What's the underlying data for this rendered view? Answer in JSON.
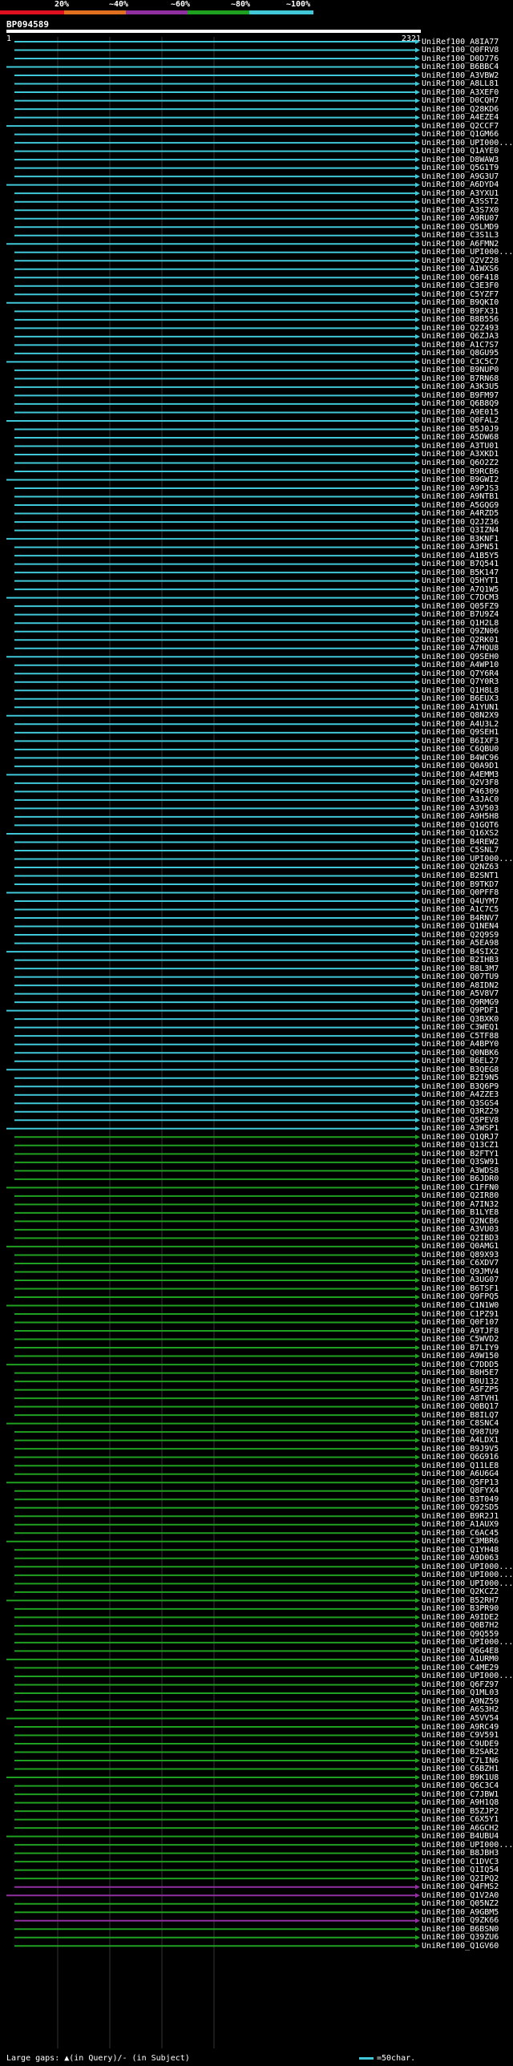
{
  "scale": {
    "labels": [
      "20%",
      "~40%",
      "~60%",
      "~80%",
      "~100%"
    ],
    "colors": [
      "#e01020",
      "#e07020",
      "#9030a0",
      "#20a020",
      "#40c8d8"
    ]
  },
  "query": {
    "name": "BP094589",
    "start": "1",
    "end": "2321"
  },
  "hits": [
    "UniRef100_A8IA77",
    "UniRef100_Q0FRV8",
    "UniRef100_D0D776",
    "UniRef100_B6BBC4",
    "UniRef100_A3VBW2",
    "UniRef100_A8LL81",
    "UniRef100_A3XEF0",
    "UniRef100_D0CQH7",
    "UniRef100_Q28KD6",
    "UniRef100_A4EZE4",
    "UniRef100_Q2CCF7",
    "UniRef100_Q1GM66",
    "UniRef100_UPI000...",
    "UniRef100_Q1AYE0",
    "UniRef100_D8WAW3",
    "UniRef100_Q5G1T9",
    "UniRef100_A9G3U7",
    "UniRef100_A6DYD4",
    "UniRef100_A3YXU1",
    "UniRef100_A3SST2",
    "UniRef100_A3S7X0",
    "UniRef100_A9RU07",
    "UniRef100_Q5LMD9",
    "UniRef100_C3S1L3",
    "UniRef100_A6FMN2",
    "UniRef100_UPI000...",
    "UniRef100_Q2VZ28",
    "UniRef100_A1WXS6",
    "UniRef100_Q6F418",
    "UniRef100_C3E3F0",
    "UniRef100_C5YZF7",
    "UniRef100_B9QKI0",
    "UniRef100_B9FX31",
    "UniRef100_B8B556",
    "UniRef100_Q2Z493",
    "UniRef100_Q6ZJA3",
    "UniRef100_A1C7S7",
    "UniRef100_Q8GU95",
    "UniRef100_C3C5C7",
    "UniRef100_B9NUP0",
    "UniRef100_B7RN68",
    "UniRef100_A3K3U5",
    "UniRef100_B9FM97",
    "UniRef100_Q6B8Q9",
    "UniRef100_A9E015",
    "UniRef100_Q0FAL2",
    "UniRef100_B5J0J9",
    "UniRef100_A5DW68",
    "UniRef100_A3TU01",
    "UniRef100_A3XKD1",
    "UniRef100_Q6O2Z2",
    "UniRef100_B9RCB6",
    "UniRef100_B9GWI2",
    "UniRef100_A9PJS3",
    "UniRef100_A9NTB1",
    "UniRef100_A5GQG9",
    "UniRef100_A4RZD5",
    "UniRef100_Q2JZ36",
    "UniRef100_Q3IZN4",
    "UniRef100_B3KNF1",
    "UniRef100_A3PN51",
    "UniRef100_A1B5Y5",
    "UniRef100_B7Q541",
    "UniRef100_B5K147",
    "UniRef100_Q5HYT1",
    "UniRef100_A7Q1W5",
    "UniRef100_C7DCM3",
    "UniRef100_Q05FZ9",
    "UniRef100_B7U9Z4",
    "UniRef100_Q1H2L8",
    "UniRef100_Q9ZN06",
    "UniRef100_Q2RK01",
    "UniRef100_A7HQU8",
    "UniRef100_Q9SEH0",
    "UniRef100_A4WP10",
    "UniRef100_Q7Y6R4",
    "UniRef100_Q7Y0R3",
    "UniRef100_Q1H8L8",
    "UniRef100_B6EUX3",
    "UniRef100_A1YUN1",
    "UniRef100_Q8N2X9",
    "UniRef100_A4U3L2",
    "UniRef100_Q9SEH1",
    "UniRef100_B6IXF3",
    "UniRef100_C6QBU0",
    "UniRef100_B4WC96",
    "UniRef100_Q0A9D1",
    "UniRef100_A4EMM3",
    "UniRef100_Q2V3F8",
    "UniRef100_P46309",
    "UniRef100_A3JAC0",
    "UniRef100_A3V503",
    "UniRef100_A9H5H8",
    "UniRef100_Q1GQT6",
    "UniRef100_Q16XS2",
    "UniRef100_B4REW2",
    "UniRef100_C5SNL7",
    "UniRef100_UPI000...",
    "UniRef100_Q2NZ63",
    "UniRef100_B2SNT1",
    "UniRef100_B9TKD7",
    "UniRef100_Q0PFF8",
    "UniRef100_Q4UYM7",
    "UniRef100_A1C7C5",
    "UniRef100_B4RNV7",
    "UniRef100_Q1NEN4",
    "UniRef100_Q2Q9S9",
    "UniRef100_A5EA98",
    "UniRef100_B4SIX2",
    "UniRef100_B2IHB3",
    "UniRef100_B8L3M7",
    "UniRef100_Q07TU9",
    "UniRef100_A8IDN2",
    "UniRef100_A5V8V7",
    "UniRef100_Q9RMG9",
    "UniRef100_Q9PDF1",
    "UniRef100_Q3BXK0",
    "UniRef100_C3WEQ1",
    "UniRef100_C5TF88",
    "UniRef100_A4BPY0",
    "UniRef100_Q0NBK6",
    "UniRef100_B6EL27",
    "UniRef100_B3QEG8",
    "UniRef100_B2I9N5",
    "UniRef100_B3Q6P9",
    "UniRef100_A4ZZE3",
    "UniRef100_Q3SGS4",
    "UniRef100_Q3RZ29",
    "UniRef100_Q5PEV8",
    "UniRef100_A3WSP1",
    "UniRef100_Q1QRJ7",
    "UniRef100_Q13CZ1",
    "UniRef100_B2FTY1",
    "UniRef100_Q3SW91",
    "UniRef100_A3WDS8",
    "UniRef100_B6JDR0",
    "UniRef100_C1FFN0",
    "UniRef100_Q2IR80",
    "UniRef100_A7IN32",
    "UniRef100_B1LYE8",
    "UniRef100_Q2NCB6",
    "UniRef100_A3VU03",
    "UniRef100_Q2IBD3",
    "UniRef100_Q0AMG1",
    "UniRef100_Q89X93",
    "UniRef100_C6XDV7",
    "UniRef100_Q9JMV4",
    "UniRef100_A3UG07",
    "UniRef100_B6TSF1",
    "UniRef100_Q9FPQ5",
    "UniRef100_C1N1W0",
    "UniRef100_C1PZ91",
    "UniRef100_Q0F107",
    "UniRef100_A9TJF8",
    "UniRef100_C5WVD2",
    "UniRef100_B7LIY9",
    "UniRef100_A9W150",
    "UniRef100_C7DDD5",
    "UniRef100_B8H5E7",
    "UniRef100_B0U132",
    "UniRef100_A5FZP5",
    "UniRef100_A8TVH1",
    "UniRef100_Q0BQ17",
    "UniRef100_B8ILQ7",
    "UniRef100_C8SNC4",
    "UniRef100_Q987U9",
    "UniRef100_A4LDX1",
    "UniRef100_B9J9V5",
    "UniRef100_Q6G916",
    "UniRef100_Q11LE8",
    "UniRef100_A6U6G4",
    "UniRef100_Q5FP13",
    "UniRef100_Q8FYX4",
    "UniRef100_B3T049",
    "UniRef100_Q92SD5",
    "UniRef100_B9R2J1",
    "UniRef100_A1AUX9",
    "UniRef100_C6AC45",
    "UniRef100_C3MBR6",
    "UniRef100_Q1YH48",
    "UniRef100_A9D063",
    "UniRef100_UPI000...",
    "UniRef100_UPI000...",
    "UniRef100_UPI000...",
    "UniRef100_Q2KCZ2",
    "UniRef100_B52RH7",
    "UniRef100_B3PR90",
    "UniRef100_A9IDE2",
    "UniRef100_Q0B7H2",
    "UniRef100_Q9Q559",
    "UniRef100_UPI000...",
    "UniRef100_Q6G4E8",
    "UniRef100_A1URM0",
    "UniRef100_C4ME29",
    "UniRef100_UPI000...",
    "UniRef100_Q6FZ97",
    "UniRef100_Q1ML03",
    "UniRef100_A9NZ59",
    "UniRef100_A6S3H2",
    "UniRef100_A5VV54",
    "UniRef100_A9RC49",
    "UniRef100_C9V591",
    "UniRef100_C9UDE9",
    "UniRef100_B2SAR2",
    "UniRef100_C7LIN6",
    "UniRef100_C6BZH1",
    "UniRef100_B9K1U8",
    "UniRef100_Q6C3C4",
    "UniRef100_C7JBW1",
    "UniRef100_A9H1Q8",
    "UniRef100_B5ZJP2",
    "UniRef100_C6X5Y1",
    "UniRef100_A6GCH2",
    "UniRef100_B4UBU4",
    "UniRef100_UPI000...",
    "UniRef100_B8JBH3",
    "UniRef100_C1DVC3",
    "UniRef100_Q1IQ54",
    "UniRef100_Q2IPQ2",
    "UniRef100_Q4FMS2",
    "UniRef100_Q1V2A0",
    "UniRef100_Q05NZ2",
    "UniRef100_A9GBM5",
    "UniRef100_Q9ZK66",
    "UniRef100_B6BSN0",
    "UniRef100_Q39ZU6",
    "UniRef100_Q1GV60"
  ],
  "footer": {
    "legend_left": "Large gaps: ▲(in Query)/- (in Subject)",
    "legend_right": "=50char."
  }
}
